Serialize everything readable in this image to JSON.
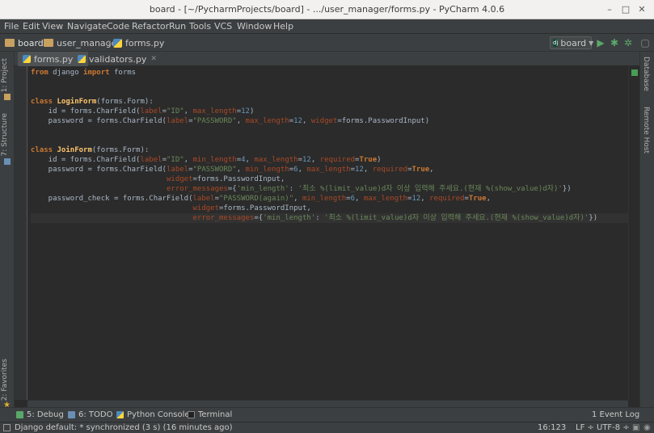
{
  "window": {
    "title": "board - [~/PycharmProjects/board] - .../user_manager/forms.py - PyCharm 4.0.6"
  },
  "menu": [
    "File",
    "Edit",
    "View",
    "Navigate",
    "Code",
    "Refactor",
    "Run",
    "Tools",
    "VCS",
    "Window",
    "Help"
  ],
  "breadcrumbs": [
    "board",
    "user_manager",
    "forms.py"
  ],
  "run_config": {
    "label": "board"
  },
  "left_tools": [
    "1: Project",
    "7: Structure",
    "2: Favorites"
  ],
  "right_tools": [
    "Database",
    "Remote Host"
  ],
  "tabs": [
    {
      "label": "forms.py",
      "active": true
    },
    {
      "label": "validators.py",
      "active": false
    }
  ],
  "code_lines": [
    "from django import forms",
    "",
    "",
    "class LoginForm(forms.Form):",
    "    id = forms.CharField(label=\"ID\", max_length=12)",
    "    password = forms.CharField(label=\"PASSWORD\", max_length=12, widget=forms.PasswordInput)",
    "",
    "",
    "class JoinForm(forms.Form):",
    "    id = forms.CharField(label=\"ID\", min_length=4, max_length=12, required=True)",
    "    password = forms.CharField(label=\"PASSWORD\", min_length=6, max_length=12, required=True,",
    "                               widget=forms.PasswordInput,",
    "                               error_messages={'min_length': '최소 %(limit_value)d자 이상 입력해 주세요.(현재 %(show_value)d자)'})",
    "    password_check = forms.CharField(label=\"PASSWORD(again)\", min_length=6, max_length=12, required=True,",
    "                                     widget=forms.PasswordInput,",
    "                                     error_messages={'min_length': '최소 %(limit_value)d자 이상 입력해 주세요.(현재 %(show_value)d자)'})"
  ],
  "bottom_tools": [
    "5: Debug",
    "6: TODO",
    "Python Console",
    "Terminal",
    "1 Event Log"
  ],
  "status": {
    "message": "Django default: * synchronized (3 s) (16 minutes ago)",
    "position": "16:123",
    "line_sep": "LF ÷",
    "encoding": "UTF-8 ÷"
  },
  "colors": {
    "keyword": "#cc7832",
    "string": "#6a8759",
    "number": "#6897bb",
    "class_name": "#ffc66d",
    "param": "#aa4926",
    "editor_bg": "#2b2b2b"
  }
}
